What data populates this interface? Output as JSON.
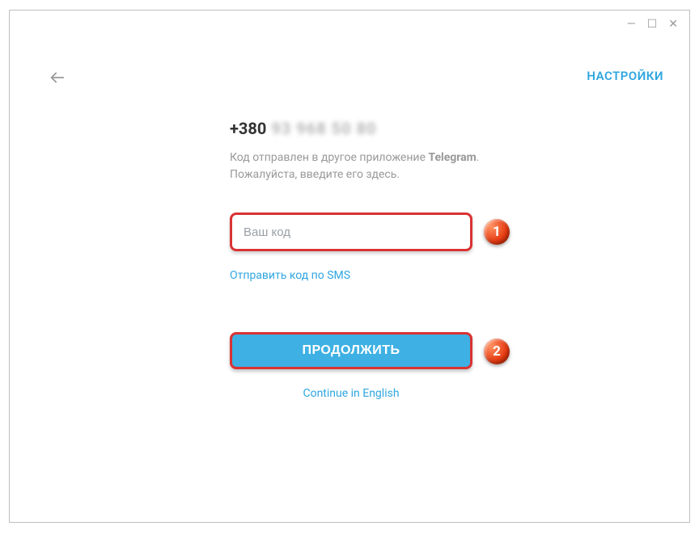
{
  "window": {
    "minimize": "—",
    "maximize": "☐",
    "close": "✕"
  },
  "header": {
    "settings": "НАСТРОЙКИ"
  },
  "phone": {
    "prefix": "+380",
    "masked": "93 968 50 80"
  },
  "info": {
    "line1_pre": "Код отправлен в другое приложение ",
    "line1_bold": "Telegram",
    "line1_post": ".",
    "line2": "Пожалуйста, введите его здесь."
  },
  "code": {
    "placeholder": "Ваш код"
  },
  "links": {
    "sms": "Отправить код по SMS",
    "continue": "ПРОДОЛЖИТЬ",
    "english": "Continue in English"
  },
  "badges": {
    "b1": "1",
    "b2": "2"
  }
}
